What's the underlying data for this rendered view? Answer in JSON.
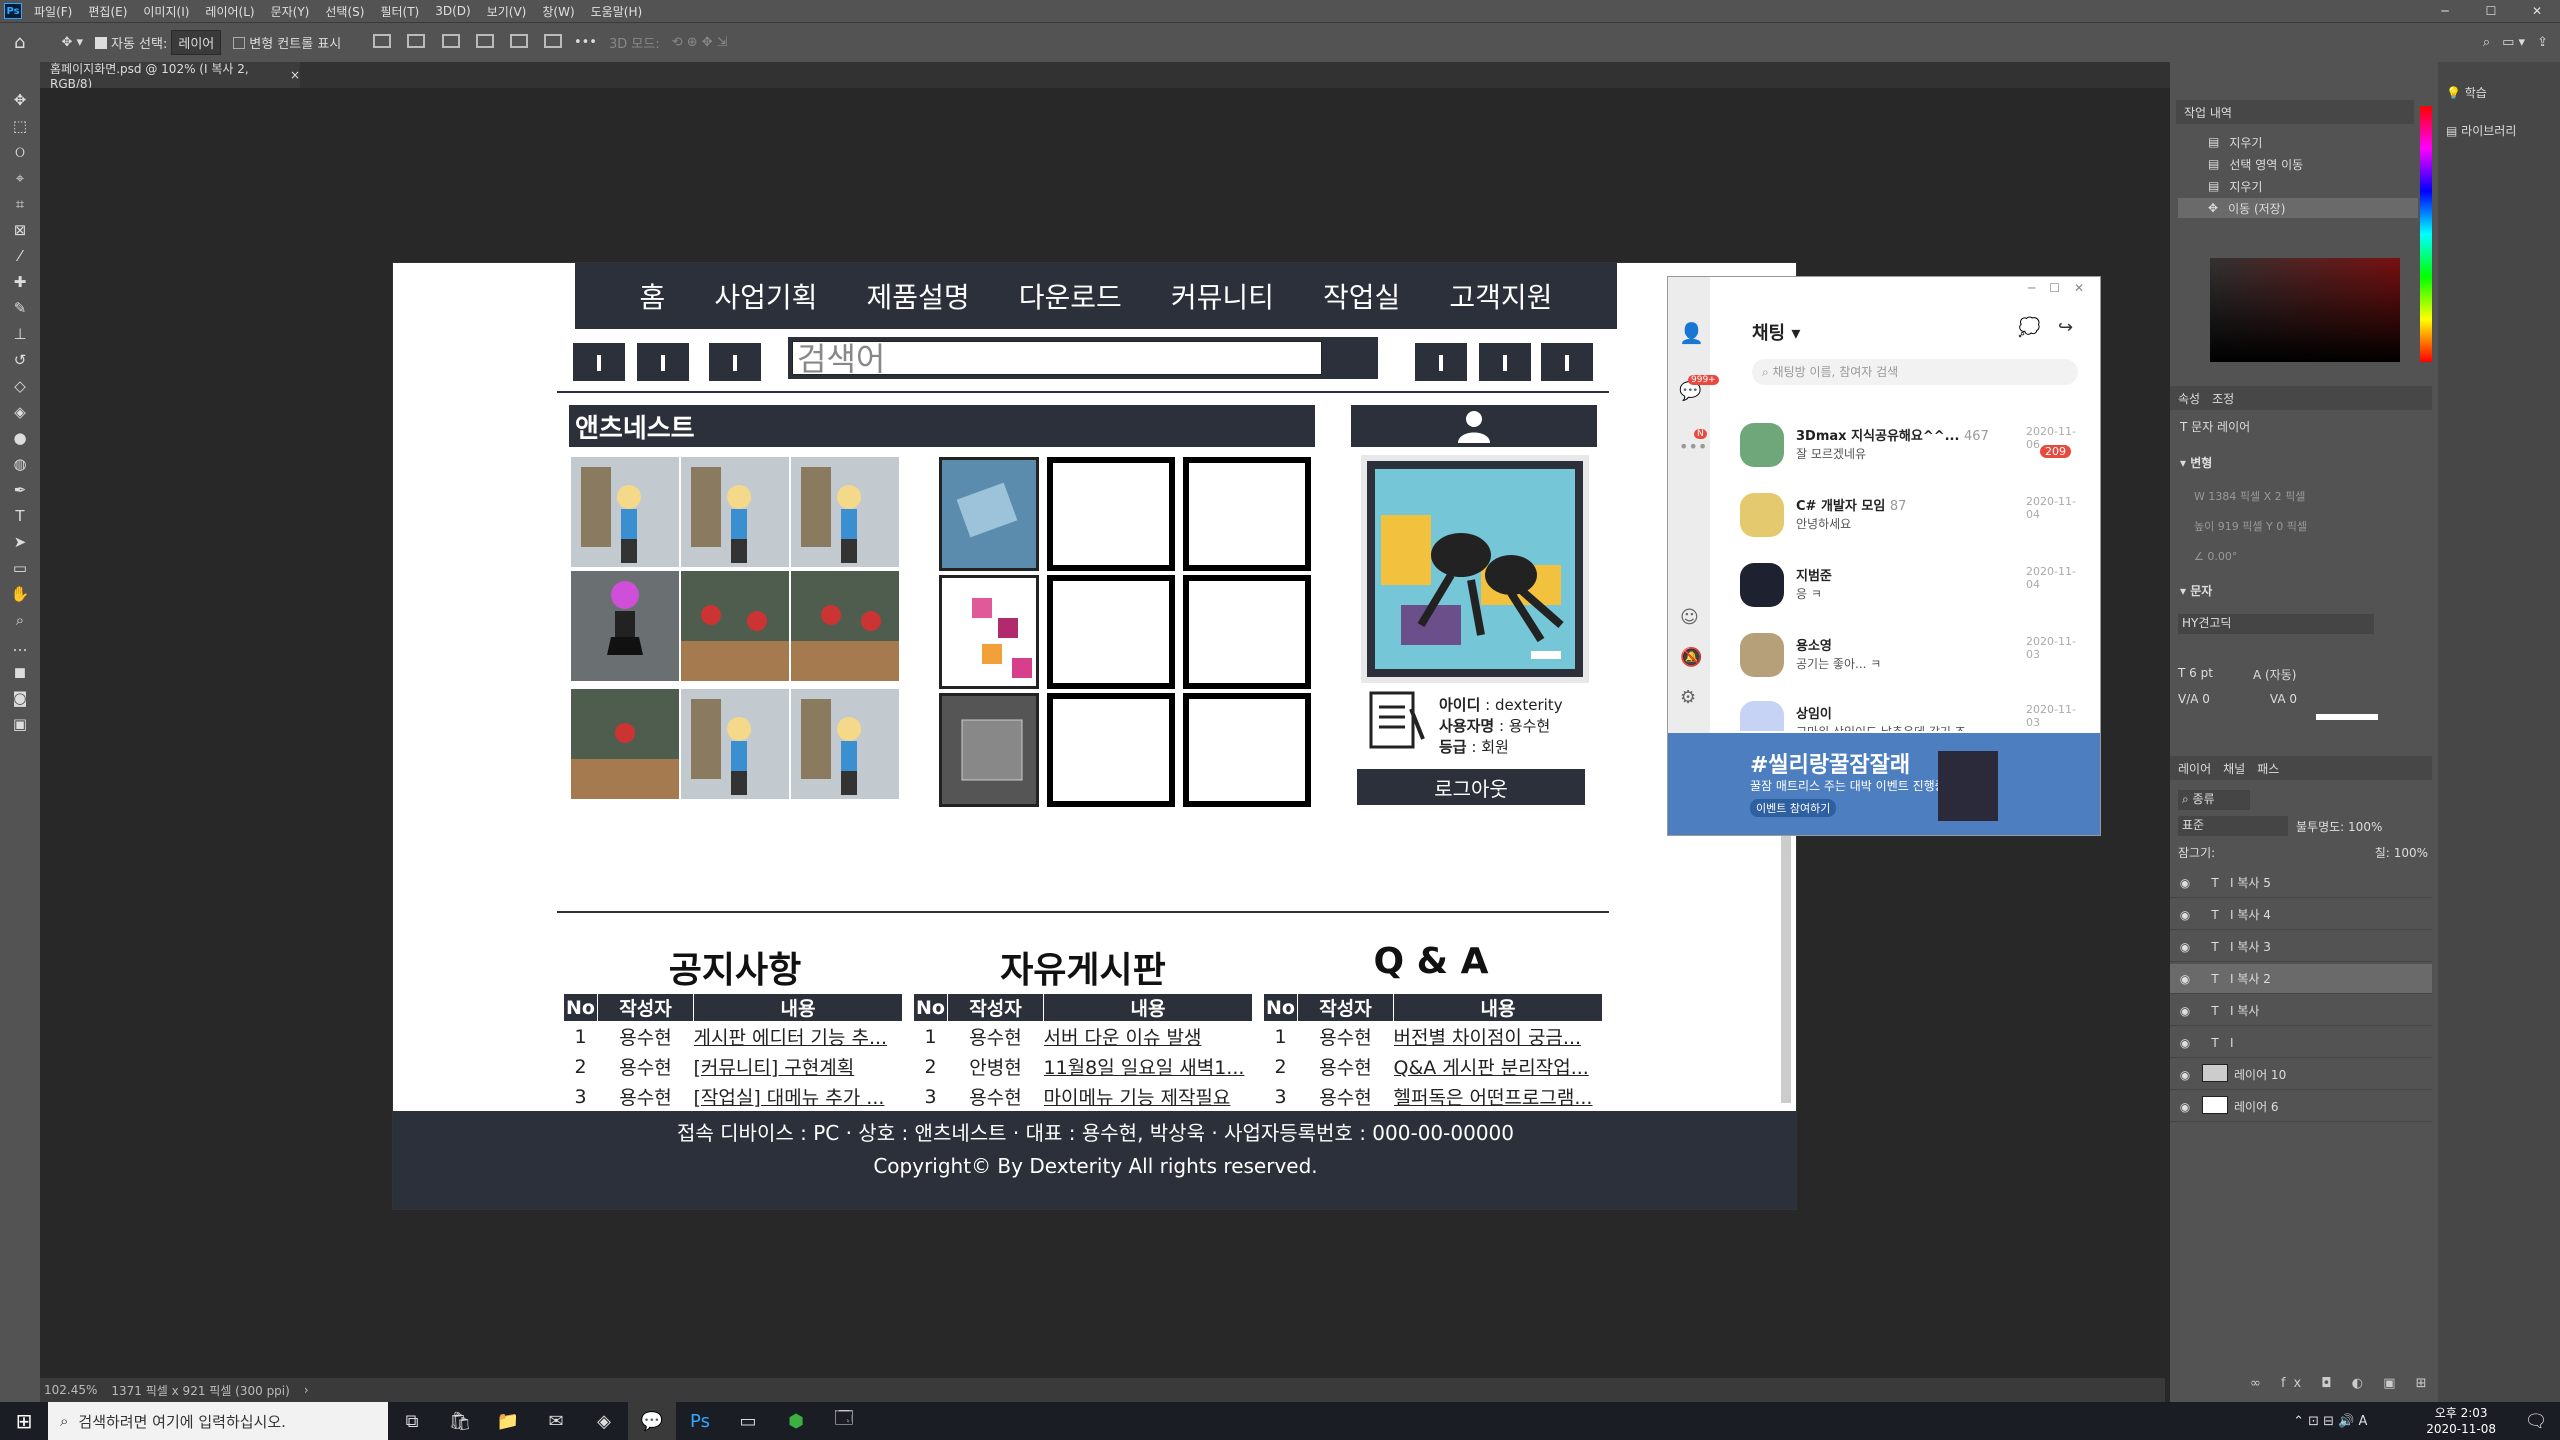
{
  "menu": {
    "ps_label": "Ps",
    "items": [
      "파일(F)",
      "편집(E)",
      "이미지(I)",
      "레이어(L)",
      "문자(Y)",
      "선택(S)",
      "필터(T)",
      "3D(D)",
      "보기(V)",
      "창(W)",
      "도움말(H)"
    ]
  },
  "options": {
    "auto_select_label": "자동 선택:",
    "auto_select_value": "레이어",
    "transform_label": "변형 컨트롤 표시",
    "mode_3d": "3D 모드:"
  },
  "document_tab": {
    "title": "홈페이지화면.psd @ 102% (I 복사 2, RGB/8)"
  },
  "status": {
    "zoom": "102.45%",
    "size": "1371 픽셀 x 921 픽셀 (300 ppi)"
  },
  "site": {
    "nav": [
      "홈",
      "사업기획",
      "제품설명",
      "다운로드",
      "커뮤니티",
      "작업실",
      "고객지원"
    ],
    "search_placeholder": "검색어",
    "brand": "앤츠네스트",
    "user": {
      "id_label": "아이디",
      "id_value": "dexterity",
      "name_label": "사용자명",
      "name_value": "용수현",
      "grade_label": "등급",
      "grade_value": "회원",
      "logout": "로그아웃"
    },
    "boards": [
      {
        "title": "공지사항",
        "headers": [
          "No",
          "작성자",
          "내용"
        ],
        "rows": [
          [
            "1",
            "용수현",
            "게시판 에디터 기능 추..."
          ],
          [
            "2",
            "용수현",
            "[커뮤니티] 구현계획"
          ],
          [
            "3",
            "용수현",
            "[작업실] 대메뉴 추가 ..."
          ]
        ]
      },
      {
        "title": "자유게시판",
        "headers": [
          "No",
          "작성자",
          "내용"
        ],
        "rows": [
          [
            "1",
            "용수현",
            "서버 다운 이슈 발생"
          ],
          [
            "2",
            "안병현",
            "11월8일 일요일 새벽1..."
          ],
          [
            "3",
            "용수현",
            "마이메뉴 기능 제작필요"
          ]
        ]
      },
      {
        "title": "Q & A",
        "headers": [
          "No",
          "작성자",
          "내용"
        ],
        "rows": [
          [
            "1",
            "용수현",
            "버전별 차이점이 궁금..."
          ],
          [
            "2",
            "용수현",
            "Q&A 게시판 분리작업..."
          ],
          [
            "3",
            "용수현",
            "헬퍼독은 어떤프로그램..."
          ]
        ]
      }
    ],
    "footer_line1": "접속 디바이스 : PC · 상호 : 앤츠네스트 · 대표 : 용수현, 박상욱 · 사업자등록번호 : 000-00-00000",
    "footer_line2": "Copyright© By Dexterity All rights reserved."
  },
  "chat": {
    "title": "채팅",
    "search_placeholder": "채팅방 이름, 참여자 검색",
    "side_badge": "999+",
    "side_badge2": "N",
    "rooms": [
      {
        "name": "3Dmax 지식공유해요^^...",
        "count": "467",
        "msg": "잘 모르겠네유",
        "date": "2020-11-06",
        "badge": "209"
      },
      {
        "name": "C# 개발자 모임",
        "count": "87",
        "msg": "안녕하세요",
        "date": "2020-11-04",
        "badge": ""
      },
      {
        "name": "지범준",
        "count": "",
        "msg": "응 ㅋ",
        "date": "2020-11-04",
        "badge": ""
      },
      {
        "name": "용소영",
        "count": "",
        "msg": "공기는 좋아... ㅋ",
        "date": "2020-11-03",
        "badge": ""
      },
      {
        "name": "상임이",
        "count": "",
        "msg": "고마워 상임이도 날추운데 감기 조",
        "date": "2020-11-03",
        "badge": ""
      }
    ],
    "ad_title": "#씰리랑꿀잠잘래",
    "ad_sub": "꿀잠 매트리스 주는 대박 이벤트 진행중!",
    "ad_btn": "이벤트 참여하기"
  },
  "panels": {
    "history_title": "작업 내역",
    "history": [
      "지우기",
      "선택 영역 이동",
      "지우기",
      "이동 (저장)"
    ],
    "props_tabs": [
      "속성",
      "조정"
    ],
    "props_type": "문자 레이어",
    "transform": "변형",
    "transform_w": "W",
    "transform_w_val": "1384 픽셀",
    "transform_h_label": "높이",
    "transform_h_val": "919 픽셀",
    "transform_x": "X",
    "transform_x_val": "2 픽셀",
    "transform_y": "Y",
    "transform_y_val": "0 픽셀",
    "transform_angle": "0.00°",
    "char": "문자",
    "font": "HY견고딕",
    "font_size": "6 pt",
    "leading": "(자동)",
    "tracking": "0",
    "kerning": "0",
    "layers_tabs": [
      "레이어",
      "채널",
      "패스"
    ],
    "layer_kind": "종류",
    "blend": "표준",
    "opacity_label": "불투명도:",
    "opacity": "100%",
    "lock_label": "잠그기:",
    "fill_label": "칠:",
    "fill": "100%",
    "layers": [
      {
        "type": "T",
        "name": "I 복사 5"
      },
      {
        "type": "T",
        "name": "I 복사 4"
      },
      {
        "type": "T",
        "name": "I 복사 3"
      },
      {
        "type": "T",
        "name": "I 복사 2"
      },
      {
        "type": "T",
        "name": "I 복사"
      },
      {
        "type": "T",
        "name": "I"
      },
      {
        "type": "img",
        "name": "레이어 10"
      },
      {
        "type": "img",
        "name": "레이어 6"
      }
    ],
    "learn": "학습",
    "library": "라이브러리"
  },
  "taskbar": {
    "search_placeholder": "검색하려면 여기에 입력하십시오.",
    "time": "오후 2:03",
    "date": "2020-11-08"
  },
  "colors": {
    "dark": "#2b303b",
    "ps_bg": "#535353",
    "canvas_bg": "#282828"
  }
}
